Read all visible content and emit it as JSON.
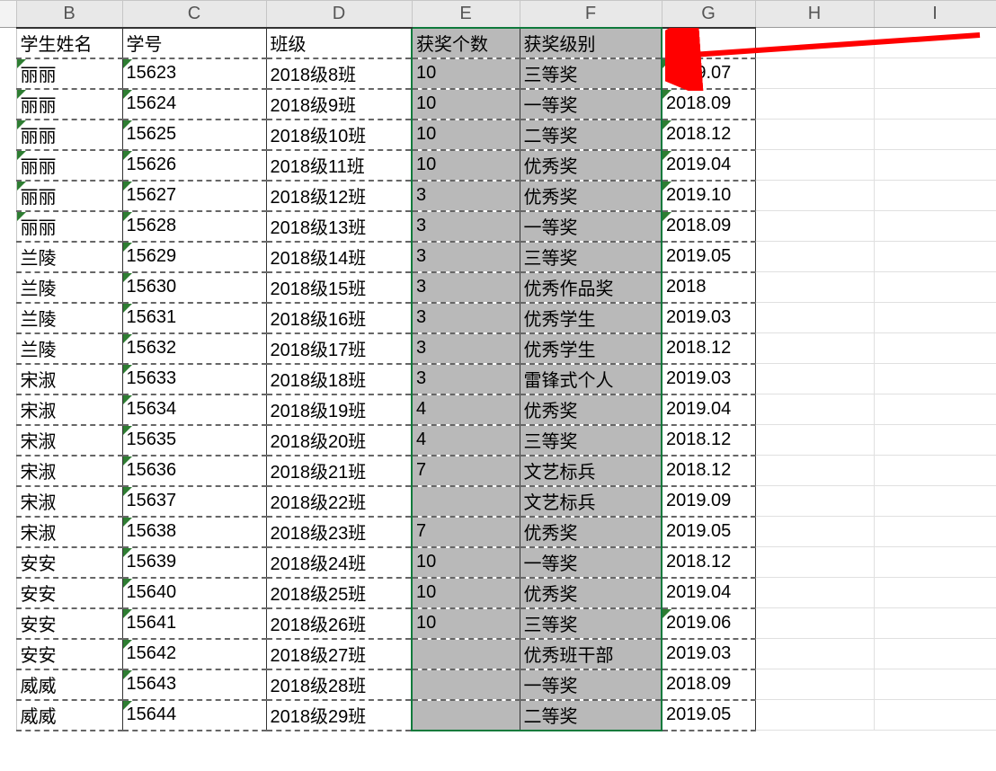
{
  "columns": [
    "B",
    "C",
    "D",
    "E",
    "F",
    "G",
    "H",
    "I"
  ],
  "headers": {
    "B": "学生姓名",
    "C": "学号",
    "D": "班级",
    "E": "获奖个数",
    "F": "获奖级别",
    "G": "获"
  },
  "rows": [
    {
      "B": "丽丽",
      "C": "15623",
      "D": "2018级8班",
      "E": "10",
      "F": "三等奖",
      "G": "2019.07"
    },
    {
      "B": "丽丽",
      "C": "15624",
      "D": "2018级9班",
      "E": "10",
      "F": "一等奖",
      "G": "2018.09"
    },
    {
      "B": "丽丽",
      "C": "15625",
      "D": "2018级10班",
      "E": "10",
      "F": "二等奖",
      "G": "2018.12"
    },
    {
      "B": "丽丽",
      "C": "15626",
      "D": "2018级11班",
      "E": "10",
      "F": "优秀奖",
      "G": "2019.04"
    },
    {
      "B": "丽丽",
      "C": "15627",
      "D": "2018级12班",
      "E": "3",
      "F": "优秀奖",
      "G": "2019.10"
    },
    {
      "B": "丽丽",
      "C": "15628",
      "D": "2018级13班",
      "E": "3",
      "F": "一等奖",
      "G": "2018.09"
    },
    {
      "B": "兰陵",
      "C": "15629",
      "D": "2018级14班",
      "E": "3",
      "F": "三等奖",
      "G": "2019.05"
    },
    {
      "B": "兰陵",
      "C": "15630",
      "D": "2018级15班",
      "E": "3",
      "F": "优秀作品奖",
      "G": "2018"
    },
    {
      "B": "兰陵",
      "C": "15631",
      "D": "2018级16班",
      "E": "3",
      "F": "优秀学生",
      "G": "2019.03"
    },
    {
      "B": "兰陵",
      "C": "15632",
      "D": "2018级17班",
      "E": "3",
      "F": "优秀学生",
      "G": "2018.12"
    },
    {
      "B": "宋淑",
      "C": "15633",
      "D": "2018级18班",
      "E": "3",
      "F": "雷锋式个人",
      "G": "2019.03"
    },
    {
      "B": "宋淑",
      "C": "15634",
      "D": "2018级19班",
      "E": "4",
      "F": "优秀奖",
      "G": "2019.04"
    },
    {
      "B": "宋淑",
      "C": "15635",
      "D": "2018级20班",
      "E": "4",
      "F": "三等奖",
      "G": "2018.12"
    },
    {
      "B": "宋淑",
      "C": "15636",
      "D": "2018级21班",
      "E": "7",
      "F": "文艺标兵",
      "G": "2018.12"
    },
    {
      "B": "宋淑",
      "C": "15637",
      "D": "2018级22班",
      "E": "",
      "F": "文艺标兵",
      "G": "2019.09"
    },
    {
      "B": "宋淑",
      "C": "15638",
      "D": "2018级23班",
      "E": "7",
      "F": "优秀奖",
      "G": "2019.05"
    },
    {
      "B": "安安",
      "C": "15639",
      "D": "2018级24班",
      "E": "10",
      "F": "一等奖",
      "G": "2018.12"
    },
    {
      "B": "安安",
      "C": "15640",
      "D": "2018级25班",
      "E": "10",
      "F": "优秀奖",
      "G": "2019.04"
    },
    {
      "B": "安安",
      "C": "15641",
      "D": "2018级26班",
      "E": "10",
      "F": "三等奖",
      "G": "2019.06"
    },
    {
      "B": "安安",
      "C": "15642",
      "D": "2018级27班",
      "E": "",
      "F": "优秀班干部",
      "G": "2019.03"
    },
    {
      "B": "威威",
      "C": "15643",
      "D": "2018级28班",
      "E": "",
      "F": "一等奖",
      "G": "2018.09"
    },
    {
      "B": "威威",
      "C": "15644",
      "D": "2018级29班",
      "E": "",
      "F": "二等奖",
      "G": "2019.05"
    }
  ]
}
